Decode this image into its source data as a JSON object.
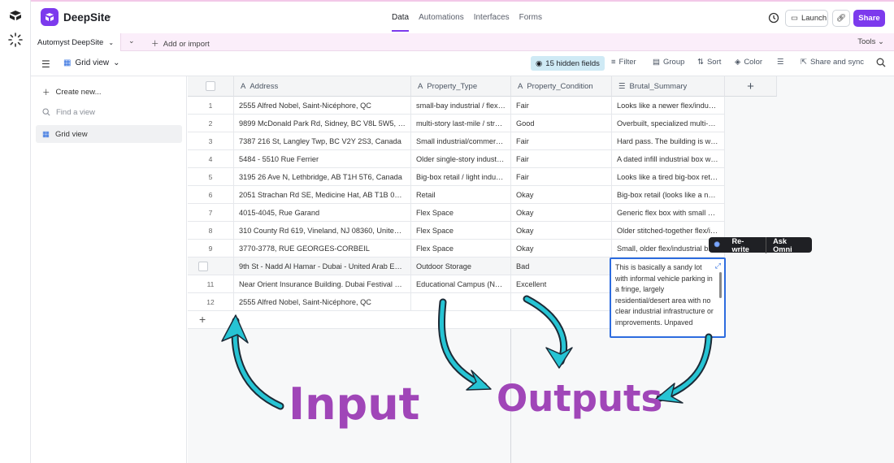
{
  "app": {
    "base_name": "DeepSite",
    "nav_tabs": [
      "Data",
      "Automations",
      "Interfaces",
      "Forms"
    ],
    "launch_label": "Launch",
    "share_label": "Share"
  },
  "tablebar": {
    "table_name": "Automyst DeepSite",
    "add_import": "Add or import",
    "tools": "Tools"
  },
  "viewbar": {
    "view_name": "Grid view",
    "hidden_fields": "15 hidden fields",
    "filter": "Filter",
    "group": "Group",
    "sort": "Sort",
    "color": "Color",
    "share_sync": "Share and sync"
  },
  "sidebar": {
    "create_new": "Create new...",
    "find_view": "Find a view",
    "grid_view": "Grid view"
  },
  "columns": [
    "Address",
    "Property_Type",
    "Property_Condition",
    "Brutal_Summary"
  ],
  "rows": [
    {
      "num": "1",
      "address": "2555 Alfred Nobel, Saint-Nicéphore, QC",
      "type": "small-bay industrial / flex ...",
      "condition": "Fair",
      "summary": "Looks like a newer flex/industri..."
    },
    {
      "num": "2",
      "address": "9899 McDonald Park Rd, Sidney, BC V8L 5W5, Can...",
      "type": "multi-story last-mile / struc...",
      "condition": "Good",
      "summary": "Overbuilt, specialized multi-sto..."
    },
    {
      "num": "3",
      "address": "7387 216 St, Langley Twp, BC V2Y 2S3, Canada",
      "type": "Small industrial/commercia...",
      "condition": "Fair",
      "summary": "Hard pass. The building is wed..."
    },
    {
      "num": "4",
      "address": "5484 - 5510 Rue Ferrier",
      "type": "Older single-story industri...",
      "condition": "Fair",
      "summary": "A dated infill industrial box wit..."
    },
    {
      "num": "5",
      "address": "3195 26 Ave N, Lethbridge, AB T1H 5T6, Canada",
      "type": "Big-box retail / light indust...",
      "condition": "Fair",
      "summary": "Looks like a tired big-box retai..."
    },
    {
      "num": "6",
      "address": "2051 Strachan Rd SE, Medicine Hat, AB T1B 0G4, C...",
      "type": "Retail",
      "condition": "Okay",
      "summary": "Big-box retail (looks like a nati..."
    },
    {
      "num": "7",
      "address": "4015-4045, Rue Garand",
      "type": "Flex Space",
      "condition": "Okay",
      "summary": "Generic flex box with small offi..."
    },
    {
      "num": "8",
      "address": "310 County Rd 619, Vineland, NJ 08360, United St...",
      "type": "Flex Space",
      "condition": "Okay",
      "summary": "Older stitched-together flex/in..."
    },
    {
      "num": "9",
      "address": "3770-3778, RUE GEORGES-CORBEIL",
      "type": "Flex Space",
      "condition": "Okay",
      "summary": "Small, older flex/industrial b..."
    },
    {
      "num": "",
      "address": "9th St - Nadd Al Hamar - Dubai - United Arab Emi...",
      "type": "Outdoor Storage",
      "condition": "Bad",
      "summary": ""
    },
    {
      "num": "11",
      "address": "Near Orient Insurance Building. Dubai Festival City...",
      "type": "Educational Campus (Non-...",
      "condition": "Excellent",
      "summary": ""
    },
    {
      "num": "12",
      "address": "2555 Alfred Nobel, Saint-Nicéphore, QC",
      "type": "",
      "condition": "",
      "summary": ""
    }
  ],
  "editor_text": "This is basically a sandy lot with informal vehicle parking in a fringe, largely residential/desert area with no clear industrial infrastructure or improvements. Unpaved",
  "ai_popover": {
    "rewrite": "Re-write",
    "ask": "Ask Omni"
  },
  "annotations": {
    "input": "Input",
    "outputs": "Outputs"
  },
  "colors": {
    "accent": "#7c3aed",
    "annotation": "#a046b8",
    "arrow": "#26c4d4",
    "selection": "#2d6cdf"
  }
}
